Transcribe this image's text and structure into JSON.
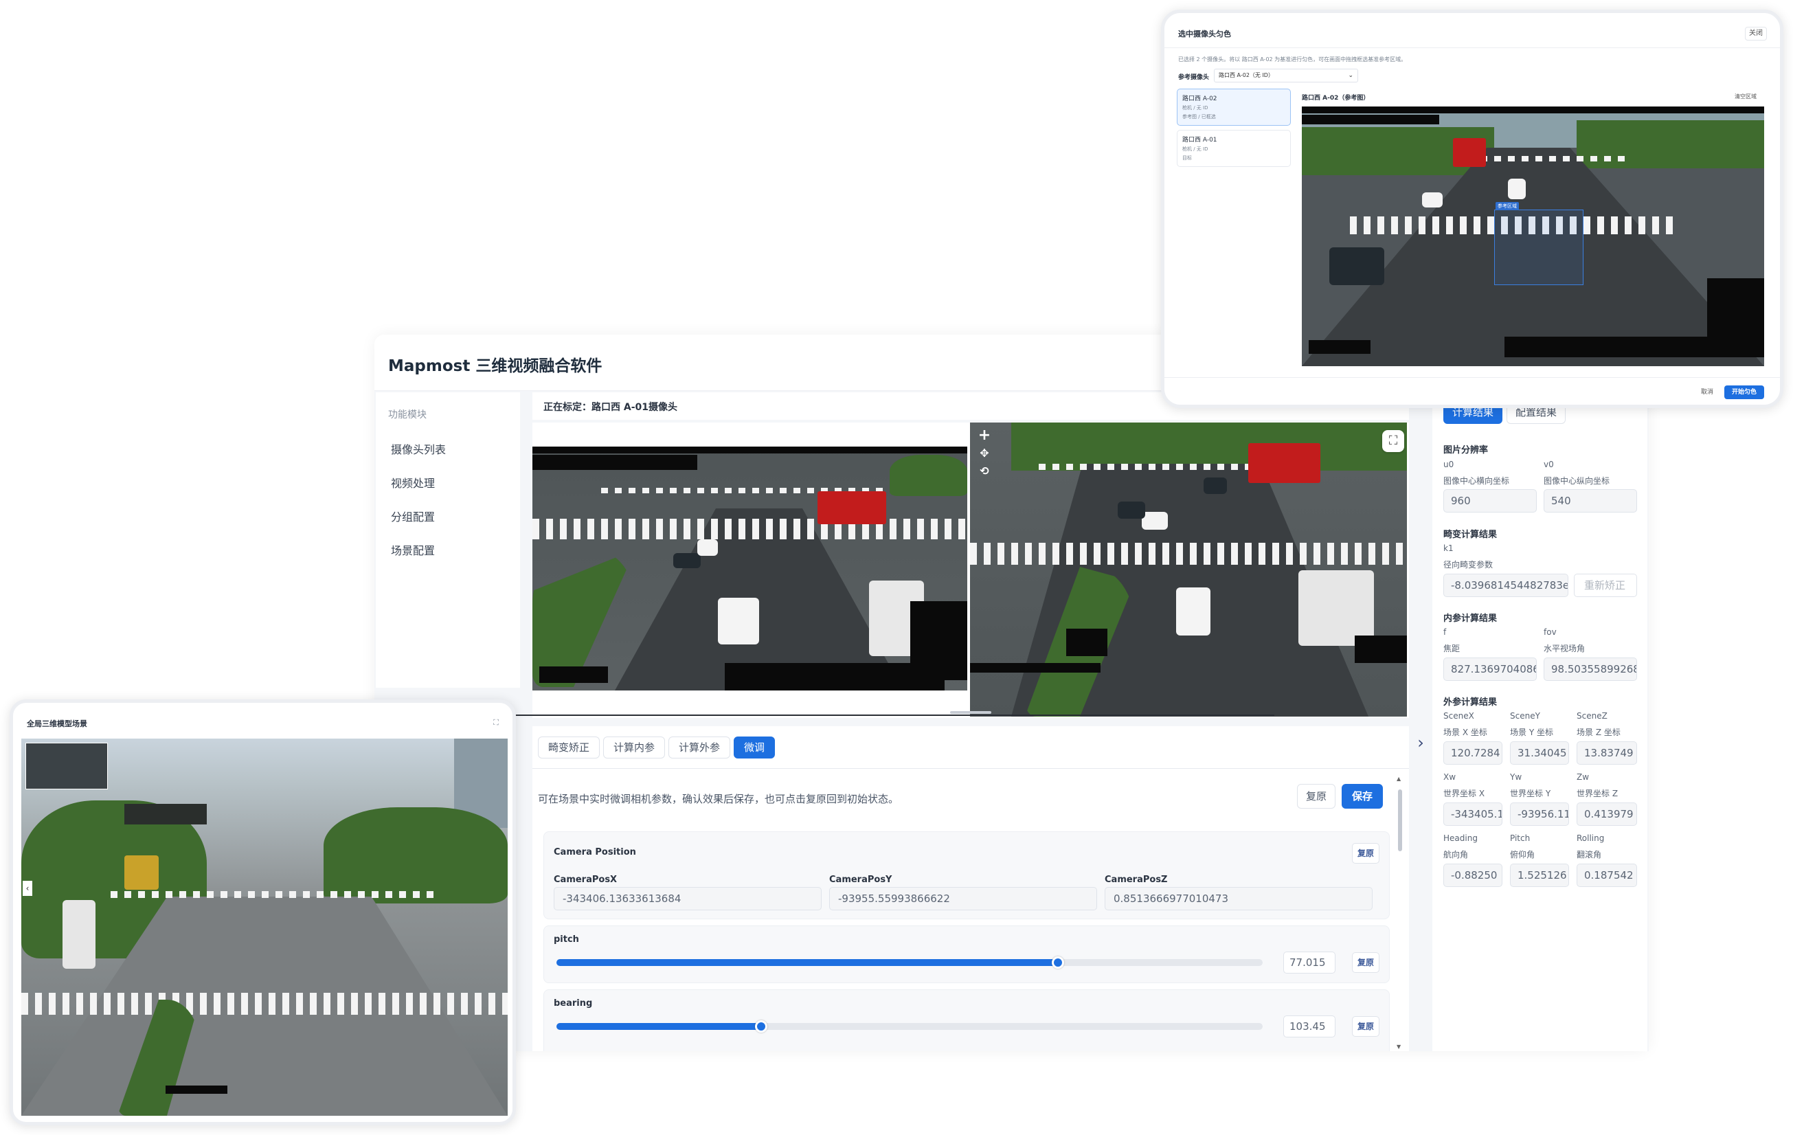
{
  "app": {
    "title": "Mapmost 三维视频融合软件"
  },
  "sidebar": {
    "heading": "功能模块",
    "items": [
      {
        "label": "摄像头列表"
      },
      {
        "label": "视频处理"
      },
      {
        "label": "分组配置"
      },
      {
        "label": "场景配置"
      }
    ]
  },
  "status": {
    "text": "正在标定：路口西 A-01摄像头"
  },
  "tabs": {
    "items": [
      {
        "label": "畸变矫正",
        "active": false
      },
      {
        "label": "计算内参",
        "active": false
      },
      {
        "label": "计算外参",
        "active": false
      },
      {
        "label": "微调",
        "active": true
      }
    ]
  },
  "finetune": {
    "tip": "可在场景中实时微调相机参数，确认效果后保存，也可点击复原回到初始状态。",
    "restore_label": "复原",
    "save_label": "保存",
    "camera_position": {
      "title": "Camera Position",
      "restore_label": "复原",
      "posx_label": "CameraPosX",
      "posx_value": "-343406.13633613684",
      "posy_label": "CameraPosY",
      "posy_value": "-93955.55993866622",
      "posz_label": "CameraPosZ",
      "posz_value": "0.8513666977010473"
    },
    "pitch": {
      "label": "pitch",
      "value_display": "77.015",
      "fill_fraction": 0.71,
      "restore_label": "复原"
    },
    "bearing": {
      "label": "bearing",
      "value_display": "103.45",
      "fill_fraction": 0.29,
      "restore_label": "复原"
    }
  },
  "result_panel": {
    "tabs": [
      {
        "label": "计算结果",
        "active": true
      },
      {
        "label": "配置结果",
        "active": false
      }
    ],
    "resolution": {
      "title": "图片分辨率",
      "u0_label": "u0",
      "u0_desc": "图像中心横向坐标",
      "u0_value": "960",
      "v0_label": "v0",
      "v0_desc": "图像中心纵向坐标",
      "v0_value": "540"
    },
    "distortion": {
      "title": "畸变计算结果",
      "k1_label": "k1",
      "k1_desc": "径向畸变参数",
      "k1_value": "-8.039681454482783e-",
      "recalc_label": "重新矫正"
    },
    "intrinsic": {
      "title": "内参计算结果",
      "f_label": "f",
      "f_desc": "焦距",
      "f_value": "827.1369704086",
      "fov_label": "fov",
      "fov_desc": "水平视场角",
      "fov_value": "98.50355899268"
    },
    "extrinsic": {
      "title": "外参计算结果",
      "scenex_label": "SceneX",
      "scenex_desc": "场景 X 坐标",
      "scenex_value": "120.7284",
      "sceney_label": "SceneY",
      "sceney_desc": "场景 Y 坐标",
      "sceney_value": "31.34045",
      "scenez_label": "SceneZ",
      "scenez_desc": "场景 Z 坐标",
      "scenez_value": "13.83749",
      "xw_label": "Xw",
      "xw_desc": "世界坐标 X",
      "xw_value": "-343405.1",
      "yw_label": "Yw",
      "yw_desc": "世界坐标 Y",
      "yw_value": "-93956.11",
      "zw_label": "Zw",
      "zw_desc": "世界坐标 Z",
      "zw_value": "0.413979",
      "heading_label": "Heading",
      "heading_desc": "航向角",
      "heading_value": "-0.88250",
      "pitch_label": "Pitch",
      "pitch_desc": "俯仰角",
      "pitch_value": "1.525126",
      "rolling_label": "Rolling",
      "rolling_desc": "翻滚角",
      "rolling_value": "0.187542"
    }
  },
  "dialog": {
    "title": "选中摄像头匀色",
    "close_label": "关闭",
    "description": "已选择 2 个摄像头。将以 路口西 A-02 为基准进行匀色，可在画面中拖拽框选基准参考区域。",
    "ref_label": "参考摄像头",
    "ref_select_value": "路口西 A-02（无 ID）",
    "cameras": [
      {
        "name": "路口西 A-02",
        "line1": "枪机 / 无 ID",
        "line2": "参考图 / 已框选",
        "selected": true
      },
      {
        "name": "路口西 A-01",
        "line1": "枪机 / 无 ID",
        "line2": "目标",
        "selected": false
      }
    ],
    "ref_view_title": "路口西 A-02（参考图）",
    "clear_label": "清空区域",
    "region_tag": "参考区域",
    "cancel_label": "取消",
    "start_label": "开始匀色"
  },
  "scene": {
    "title": "全局三维模型场景"
  },
  "colors": {
    "accent": "#1d6fe0",
    "panel_bg": "#f4f6f9",
    "truck_red": "#c21c1c"
  }
}
